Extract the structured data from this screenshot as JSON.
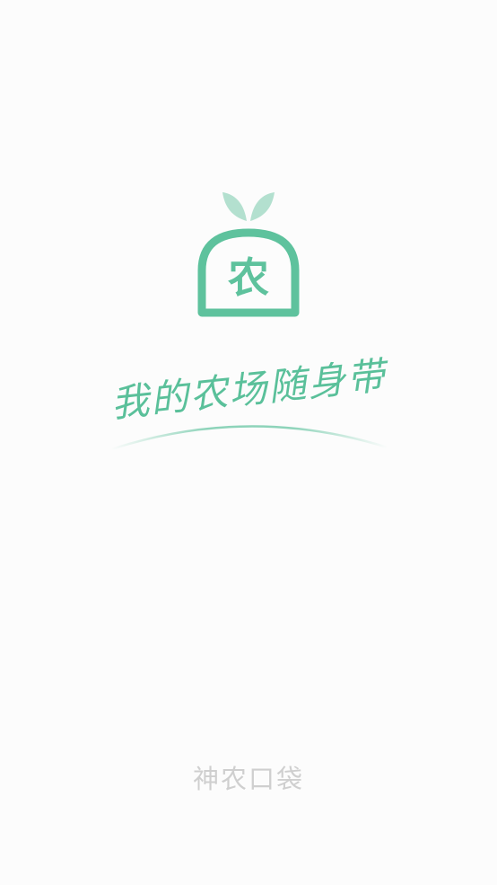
{
  "splash": {
    "logo_char": "农",
    "slogan": "我的农场随身带",
    "brand_name": "神农口袋"
  },
  "colors": {
    "brand_green": "#5ec29d",
    "leaf_light": "#b3e0cf",
    "brand_name_gray": "#cfcfcf",
    "background": "#fcfcfc"
  },
  "icons": {
    "logo": "sprout-bag-icon"
  }
}
